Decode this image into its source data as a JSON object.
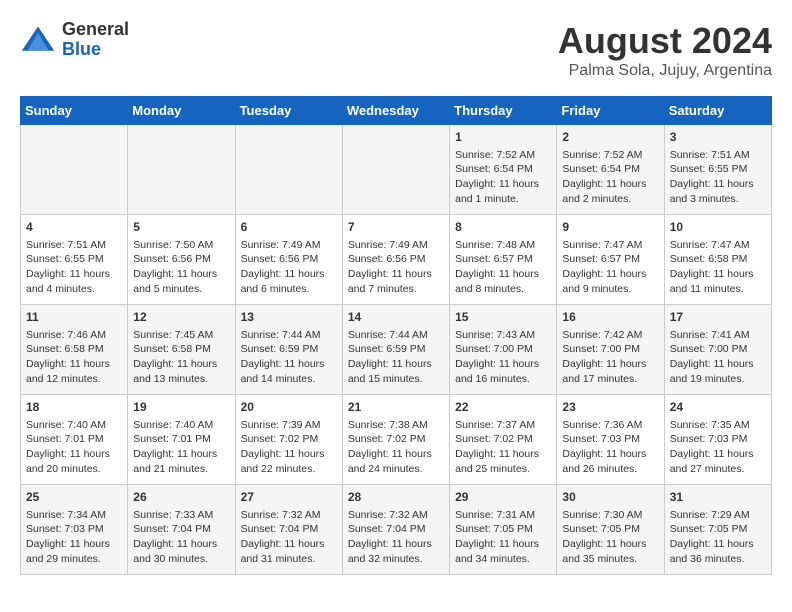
{
  "header": {
    "logo_general": "General",
    "logo_blue": "Blue",
    "month_title": "August 2024",
    "location": "Palma Sola, Jujuy, Argentina"
  },
  "days_of_week": [
    "Sunday",
    "Monday",
    "Tuesday",
    "Wednesday",
    "Thursday",
    "Friday",
    "Saturday"
  ],
  "weeks": [
    [
      {
        "day": "",
        "content": ""
      },
      {
        "day": "",
        "content": ""
      },
      {
        "day": "",
        "content": ""
      },
      {
        "day": "",
        "content": ""
      },
      {
        "day": "1",
        "content": "Sunrise: 7:52 AM\nSunset: 6:54 PM\nDaylight: 11 hours\nand 1 minute."
      },
      {
        "day": "2",
        "content": "Sunrise: 7:52 AM\nSunset: 6:54 PM\nDaylight: 11 hours\nand 2 minutes."
      },
      {
        "day": "3",
        "content": "Sunrise: 7:51 AM\nSunset: 6:55 PM\nDaylight: 11 hours\nand 3 minutes."
      }
    ],
    [
      {
        "day": "4",
        "content": "Sunrise: 7:51 AM\nSunset: 6:55 PM\nDaylight: 11 hours\nand 4 minutes."
      },
      {
        "day": "5",
        "content": "Sunrise: 7:50 AM\nSunset: 6:56 PM\nDaylight: 11 hours\nand 5 minutes."
      },
      {
        "day": "6",
        "content": "Sunrise: 7:49 AM\nSunset: 6:56 PM\nDaylight: 11 hours\nand 6 minutes."
      },
      {
        "day": "7",
        "content": "Sunrise: 7:49 AM\nSunset: 6:56 PM\nDaylight: 11 hours\nand 7 minutes."
      },
      {
        "day": "8",
        "content": "Sunrise: 7:48 AM\nSunset: 6:57 PM\nDaylight: 11 hours\nand 8 minutes."
      },
      {
        "day": "9",
        "content": "Sunrise: 7:47 AM\nSunset: 6:57 PM\nDaylight: 11 hours\nand 9 minutes."
      },
      {
        "day": "10",
        "content": "Sunrise: 7:47 AM\nSunset: 6:58 PM\nDaylight: 11 hours\nand 11 minutes."
      }
    ],
    [
      {
        "day": "11",
        "content": "Sunrise: 7:46 AM\nSunset: 6:58 PM\nDaylight: 11 hours\nand 12 minutes."
      },
      {
        "day": "12",
        "content": "Sunrise: 7:45 AM\nSunset: 6:58 PM\nDaylight: 11 hours\nand 13 minutes."
      },
      {
        "day": "13",
        "content": "Sunrise: 7:44 AM\nSunset: 6:59 PM\nDaylight: 11 hours\nand 14 minutes."
      },
      {
        "day": "14",
        "content": "Sunrise: 7:44 AM\nSunset: 6:59 PM\nDaylight: 11 hours\nand 15 minutes."
      },
      {
        "day": "15",
        "content": "Sunrise: 7:43 AM\nSunset: 7:00 PM\nDaylight: 11 hours\nand 16 minutes."
      },
      {
        "day": "16",
        "content": "Sunrise: 7:42 AM\nSunset: 7:00 PM\nDaylight: 11 hours\nand 17 minutes."
      },
      {
        "day": "17",
        "content": "Sunrise: 7:41 AM\nSunset: 7:00 PM\nDaylight: 11 hours\nand 19 minutes."
      }
    ],
    [
      {
        "day": "18",
        "content": "Sunrise: 7:40 AM\nSunset: 7:01 PM\nDaylight: 11 hours\nand 20 minutes."
      },
      {
        "day": "19",
        "content": "Sunrise: 7:40 AM\nSunset: 7:01 PM\nDaylight: 11 hours\nand 21 minutes."
      },
      {
        "day": "20",
        "content": "Sunrise: 7:39 AM\nSunset: 7:02 PM\nDaylight: 11 hours\nand 22 minutes."
      },
      {
        "day": "21",
        "content": "Sunrise: 7:38 AM\nSunset: 7:02 PM\nDaylight: 11 hours\nand 24 minutes."
      },
      {
        "day": "22",
        "content": "Sunrise: 7:37 AM\nSunset: 7:02 PM\nDaylight: 11 hours\nand 25 minutes."
      },
      {
        "day": "23",
        "content": "Sunrise: 7:36 AM\nSunset: 7:03 PM\nDaylight: 11 hours\nand 26 minutes."
      },
      {
        "day": "24",
        "content": "Sunrise: 7:35 AM\nSunset: 7:03 PM\nDaylight: 11 hours\nand 27 minutes."
      }
    ],
    [
      {
        "day": "25",
        "content": "Sunrise: 7:34 AM\nSunset: 7:03 PM\nDaylight: 11 hours\nand 29 minutes."
      },
      {
        "day": "26",
        "content": "Sunrise: 7:33 AM\nSunset: 7:04 PM\nDaylight: 11 hours\nand 30 minutes."
      },
      {
        "day": "27",
        "content": "Sunrise: 7:32 AM\nSunset: 7:04 PM\nDaylight: 11 hours\nand 31 minutes."
      },
      {
        "day": "28",
        "content": "Sunrise: 7:32 AM\nSunset: 7:04 PM\nDaylight: 11 hours\nand 32 minutes."
      },
      {
        "day": "29",
        "content": "Sunrise: 7:31 AM\nSunset: 7:05 PM\nDaylight: 11 hours\nand 34 minutes."
      },
      {
        "day": "30",
        "content": "Sunrise: 7:30 AM\nSunset: 7:05 PM\nDaylight: 11 hours\nand 35 minutes."
      },
      {
        "day": "31",
        "content": "Sunrise: 7:29 AM\nSunset: 7:05 PM\nDaylight: 11 hours\nand 36 minutes."
      }
    ]
  ]
}
